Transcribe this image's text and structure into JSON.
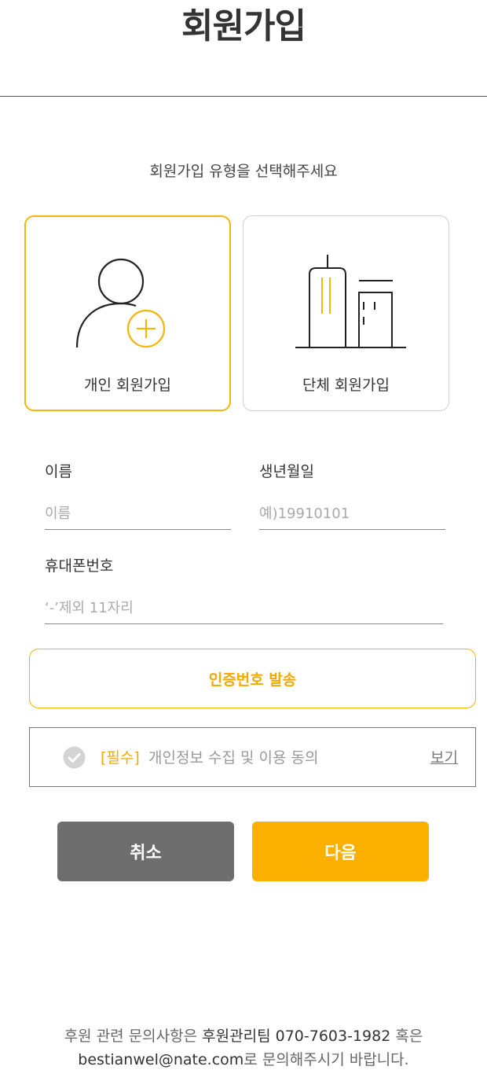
{
  "page": {
    "title": "회원가입"
  },
  "signup_type": {
    "prompt": "회원가입 유형을 선택해주세요",
    "options": [
      {
        "label": "개인 회원가입",
        "icon": "person-add-icon",
        "selected": true
      },
      {
        "label": "단체 회원가입",
        "icon": "building-icon",
        "selected": false
      }
    ]
  },
  "form": {
    "name": {
      "label": "이름",
      "placeholder": "이름",
      "value": ""
    },
    "birth": {
      "label": "생년월일",
      "placeholder": "예)19910101",
      "value": ""
    },
    "phone": {
      "label": "휴대폰번호",
      "placeholder": "‘-’제외 11자리",
      "value": ""
    }
  },
  "verify_button": {
    "label": "인증번호 발송"
  },
  "consent": {
    "required_tag": "[필수]",
    "text": "개인정보 수집 및 이용 동의",
    "view_link": "보기",
    "checked": false,
    "check_icon": "checkmark-circle-icon"
  },
  "actions": {
    "cancel_label": "취소",
    "next_label": "다음"
  },
  "footer": {
    "line1_prefix": "후원 관련 문의사항은 ",
    "team": "후원관리팀",
    "phone": "070-7603-1982",
    "line1_suffix": " 혹은",
    "email": "bestianwel@nate.com",
    "line2_suffix": "로 문의해주시기 바랍니다."
  },
  "colors": {
    "accent": "#fbb000",
    "accent_text": "#f5a800",
    "cancel": "#6e6e6e",
    "border": "#cfcfcf"
  }
}
